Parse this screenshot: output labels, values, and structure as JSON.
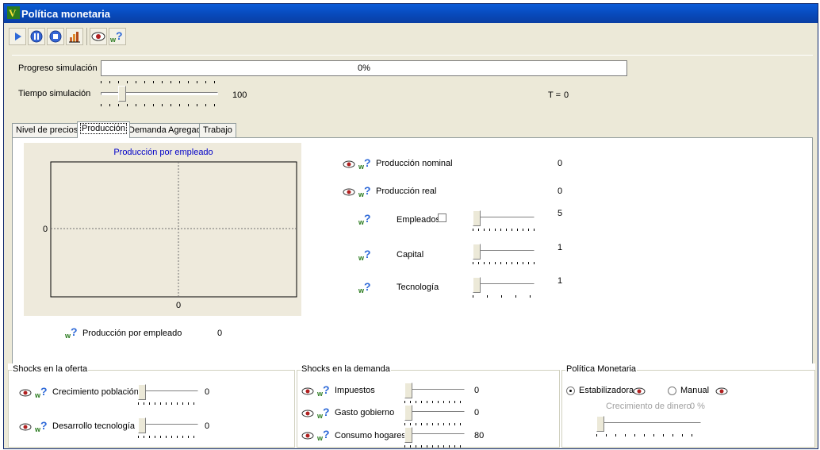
{
  "window": {
    "title": "Política monetaria"
  },
  "toolbar": {
    "buttons": [
      "play-icon",
      "pause-icon",
      "stop-icon",
      "chart-icon",
      "eye-icon",
      "help-icon"
    ]
  },
  "simulation": {
    "progress_label": "Progreso simulación",
    "progress_value": "0%",
    "time_label": "Tiempo simulación",
    "time_value": "100",
    "t_label": "T =",
    "t_value": "0"
  },
  "tabs": [
    {
      "label": "Nivel de precios"
    },
    {
      "label": "Producción"
    },
    {
      "label": "Demanda Agregada"
    },
    {
      "label": "Trabajo"
    }
  ],
  "production": {
    "chart_title": "Producción por empleado",
    "y_tick": "0",
    "x_tick": "0",
    "per_employee_label": "Producción por empleado",
    "per_employee_value": "0",
    "nominal_label": "Producción nominal",
    "nominal_value": "0",
    "real_label": "Producción real",
    "real_value": "0",
    "employees_label": "Empleados",
    "employees_value": "5",
    "capital_label": "Capital",
    "capital_value": "1",
    "technology_label": "Tecnología",
    "technology_value": "1"
  },
  "supply_shocks": {
    "title": "Shocks en la oferta",
    "population_label": "Crecimiento población",
    "population_value": "0",
    "tech_label": "Desarrollo tecnología",
    "tech_value": "0"
  },
  "demand_shocks": {
    "title": "Shocks en la demanda",
    "taxes_label": "Impuestos",
    "taxes_value": "0",
    "gov_label": "Gasto gobierno",
    "gov_value": "0",
    "consumption_label": "Consumo hogares",
    "consumption_value": "80"
  },
  "monetary_policy": {
    "title": "Política Monetaria",
    "stabilizing_label": "Estabilizadora",
    "manual_label": "Manual",
    "money_growth_label": "Crecimiento de dinero",
    "money_growth_value": "0 %"
  }
}
